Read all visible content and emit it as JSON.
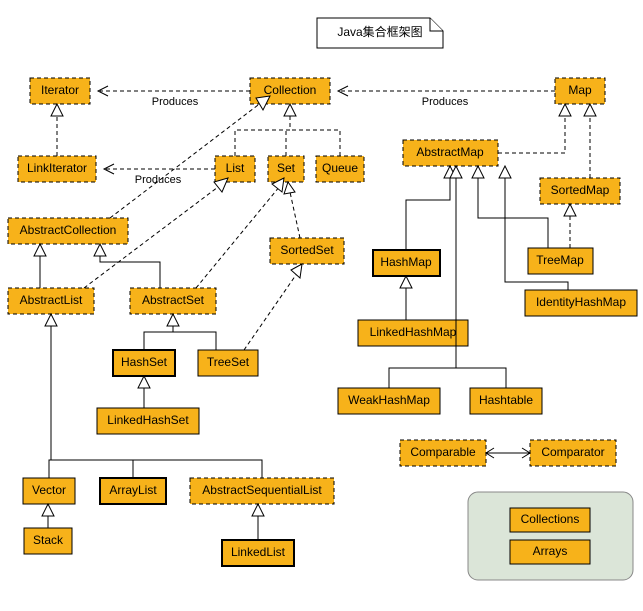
{
  "title": "Java集合框架图",
  "nodes": {
    "iterator": "Iterator",
    "collection": "Collection",
    "map": "Map",
    "linkiterator": "LinkIterator",
    "list": "List",
    "set": "Set",
    "queue": "Queue",
    "abstractmap": "AbstractMap",
    "sortedmap": "SortedMap",
    "abstractcollection": "AbstractCollection",
    "sortedset": "SortedSet",
    "hashmap": "HashMap",
    "treemap": "TreeMap",
    "abstractlist": "AbstractList",
    "abstractset": "AbstractSet",
    "identityhashmap": "IdentityHashMap",
    "hashset": "HashSet",
    "treeset": "TreeSet",
    "linkedhashmap": "LinkedHashMap",
    "linkedhashset": "LinkedHashSet",
    "weakhashmap": "WeakHashMap",
    "hashtable": "Hashtable",
    "vector": "Vector",
    "arraylist": "ArrayList",
    "abstractsequentiallist": "AbstractSequentialList",
    "comparable": "Comparable",
    "comparator": "Comparator",
    "stack": "Stack",
    "linkedlist": "LinkedList",
    "collections": "Collections",
    "arrays": "Arrays"
  },
  "edge_labels": {
    "produces1": "Produces",
    "produces2": "Produces",
    "produces3": "Produces"
  },
  "chart_data": {
    "type": "table",
    "description": "UML class diagram of Java Collections Framework",
    "interfaces": [
      "Iterator",
      "LinkIterator",
      "Collection",
      "List",
      "Set",
      "Queue",
      "Map",
      "SortedSet",
      "SortedMap",
      "Comparable",
      "Comparator"
    ],
    "abstract_classes": [
      "AbstractCollection",
      "AbstractList",
      "AbstractSet",
      "AbstractMap",
      "AbstractSequentialList"
    ],
    "concrete_classes": [
      "HashSet",
      "TreeSet",
      "LinkedHashSet",
      "Vector",
      "Stack",
      "ArrayList",
      "LinkedList",
      "HashMap",
      "LinkedHashMap",
      "TreeMap",
      "IdentityHashMap",
      "WeakHashMap",
      "Hashtable",
      "Collections",
      "Arrays"
    ],
    "edges": [
      {
        "from": "Collection",
        "to": "Iterator",
        "type": "produces"
      },
      {
        "from": "Map",
        "to": "Collection",
        "type": "produces"
      },
      {
        "from": "List",
        "to": "LinkIterator",
        "type": "produces"
      },
      {
        "from": "LinkIterator",
        "to": "Iterator",
        "type": "extends"
      },
      {
        "from": "List",
        "to": "Collection",
        "type": "extends"
      },
      {
        "from": "Set",
        "to": "Collection",
        "type": "extends"
      },
      {
        "from": "Queue",
        "to": "Collection",
        "type": "extends"
      },
      {
        "from": "SortedSet",
        "to": "Set",
        "type": "extends"
      },
      {
        "from": "SortedMap",
        "to": "Map",
        "type": "extends"
      },
      {
        "from": "AbstractCollection",
        "to": "Collection",
        "type": "implements"
      },
      {
        "from": "AbstractList",
        "to": "AbstractCollection",
        "type": "extends"
      },
      {
        "from": "AbstractList",
        "to": "List",
        "type": "implements"
      },
      {
        "from": "AbstractSet",
        "to": "AbstractCollection",
        "type": "extends"
      },
      {
        "from": "AbstractSet",
        "to": "Set",
        "type": "implements"
      },
      {
        "from": "HashSet",
        "to": "AbstractSet",
        "type": "extends"
      },
      {
        "from": "TreeSet",
        "to": "AbstractSet",
        "type": "extends"
      },
      {
        "from": "TreeSet",
        "to": "SortedSet",
        "type": "implements"
      },
      {
        "from": "LinkedHashSet",
        "to": "HashSet",
        "type": "extends"
      },
      {
        "from": "Vector",
        "to": "AbstractList",
        "type": "extends"
      },
      {
        "from": "ArrayList",
        "to": "AbstractList",
        "type": "extends"
      },
      {
        "from": "AbstractSequentialList",
        "to": "AbstractList",
        "type": "extends"
      },
      {
        "from": "Stack",
        "to": "Vector",
        "type": "extends"
      },
      {
        "from": "LinkedList",
        "to": "AbstractSequentialList",
        "type": "extends"
      },
      {
        "from": "AbstractMap",
        "to": "Map",
        "type": "implements"
      },
      {
        "from": "HashMap",
        "to": "AbstractMap",
        "type": "extends"
      },
      {
        "from": "TreeMap",
        "to": "AbstractMap",
        "type": "extends"
      },
      {
        "from": "TreeMap",
        "to": "SortedMap",
        "type": "implements"
      },
      {
        "from": "IdentityHashMap",
        "to": "AbstractMap",
        "type": "extends"
      },
      {
        "from": "WeakHashMap",
        "to": "AbstractMap",
        "type": "extends"
      },
      {
        "from": "Hashtable",
        "to": "AbstractMap",
        "type": "extends"
      },
      {
        "from": "LinkedHashMap",
        "to": "HashMap",
        "type": "extends"
      },
      {
        "from": "Comparable",
        "to": "Comparator",
        "type": "association"
      }
    ]
  }
}
